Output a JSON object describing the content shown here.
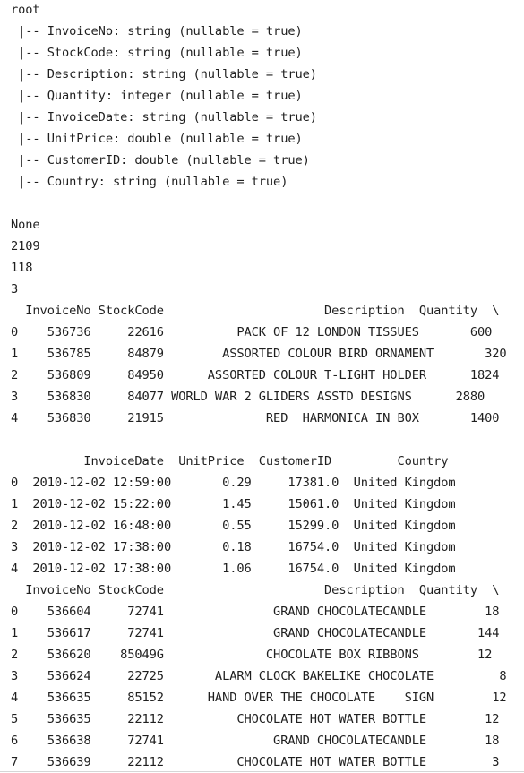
{
  "console": {
    "lines": [
      "root",
      " |-- InvoiceNo: string (nullable = true)",
      " |-- StockCode: string (nullable = true)",
      " |-- Description: string (nullable = true)",
      " |-- Quantity: integer (nullable = true)",
      " |-- InvoiceDate: string (nullable = true)",
      " |-- UnitPrice: double (nullable = true)",
      " |-- CustomerID: double (nullable = true)",
      " |-- Country: string (nullable = true)",
      "",
      "None",
      "2109",
      "118",
      "3",
      "  InvoiceNo StockCode                      Description  Quantity  \\",
      "0    536736     22616          PACK OF 12 LONDON TISSUES       600",
      "1    536785     84879        ASSORTED COLOUR BIRD ORNAMENT       320",
      "2    536809     84950      ASSORTED COLOUR T-LIGHT HOLDER      1824",
      "3    536830     84077 WORLD WAR 2 GLIDERS ASSTD DESIGNS      2880",
      "4    536830     21915              RED  HARMONICA IN BOX       1400",
      "",
      "          InvoiceDate  UnitPrice  CustomerID         Country",
      "0  2010-12-02 12:59:00       0.29     17381.0  United Kingdom",
      "1  2010-12-02 15:22:00       1.45     15061.0  United Kingdom",
      "2  2010-12-02 16:48:00       0.55     15299.0  United Kingdom",
      "3  2010-12-02 17:38:00       0.18     16754.0  United Kingdom",
      "4  2010-12-02 17:38:00       1.06     16754.0  United Kingdom",
      "  InvoiceNo StockCode                      Description  Quantity  \\",
      "0    536604     72741               GRAND CHOCOLATECANDLE        18",
      "1    536617     72741               GRAND CHOCOLATECANDLE       144",
      "2    536620    85049G              CHOCOLATE BOX RIBBONS        12",
      "3    536624     22725       ALARM CLOCK BAKELIKE CHOCOLATE         8",
      "4    536635     85152      HAND OVER THE CHOCOLATE    SIGN        12",
      "5    536635     22112          CHOCOLATE HOT WATER BOTTLE        12",
      "6    536638     72741               GRAND CHOCOLATECANDLE        18",
      "7    536639     22112          CHOCOLATE HOT WATER BOTTLE         3"
    ]
  }
}
